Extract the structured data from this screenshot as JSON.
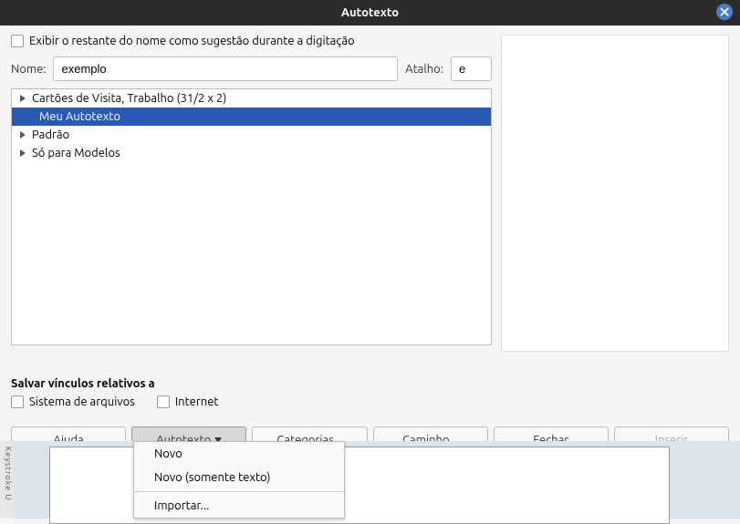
{
  "title": "Autotexto",
  "suggest_checkbox_label": "Exibir o restante do nome como sugestão durante a digitação",
  "name_label": "Nome:",
  "name_value": "exemplo",
  "shortcut_label": "Atalho:",
  "shortcut_value": "e",
  "tree": {
    "items": [
      {
        "label": "Cartões de Visita, Trabalho (31/2 x 2)",
        "expandable": true
      },
      {
        "label": "Meu Autotexto",
        "expandable": false,
        "selected": true,
        "child": true
      },
      {
        "label": "Padrão",
        "expandable": true
      },
      {
        "label": "Só para Modelos",
        "expandable": true
      }
    ]
  },
  "links": {
    "title": "Salvar vínculos relativos a",
    "filesystem": "Sistema de arquivos",
    "internet": "Internet"
  },
  "buttons": {
    "help": "Ajuda",
    "autotext": "Autotexto",
    "categories": "Categorias...",
    "path": "Caminho...",
    "close": "Fechar",
    "insert": "Inserir"
  },
  "menu": {
    "new": "Novo",
    "new_text": "Novo (somente texto)",
    "import": "Importar..."
  },
  "bg_side": "Keystroke   U"
}
